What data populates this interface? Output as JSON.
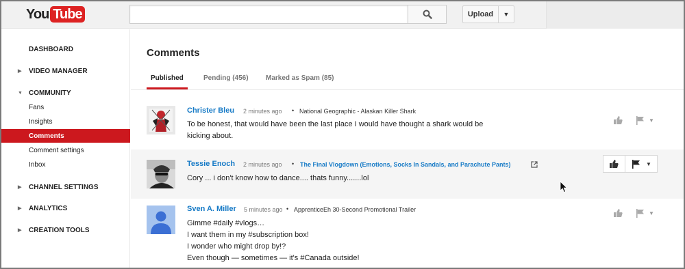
{
  "header": {
    "logo_you": "You",
    "logo_tube": "Tube",
    "search_value": "",
    "upload_label": "Upload"
  },
  "sidebar": {
    "sections": [
      {
        "label": "DASHBOARD",
        "has_arrow": false
      },
      {
        "label": "VIDEO MANAGER",
        "has_arrow": true
      },
      {
        "label": "COMMUNITY",
        "has_arrow": true,
        "expanded": true
      },
      {
        "label": "CHANNEL SETTINGS",
        "has_arrow": true
      },
      {
        "label": "ANALYTICS",
        "has_arrow": true
      },
      {
        "label": "CREATION TOOLS",
        "has_arrow": true
      }
    ],
    "community_items": [
      "Fans",
      "Insights",
      "Comments",
      "Comment settings",
      "Inbox"
    ],
    "active_item": "Comments"
  },
  "main": {
    "title": "Comments",
    "tabs": [
      {
        "label": "Published",
        "active": true
      },
      {
        "label": "Pending (456)",
        "active": false
      },
      {
        "label": "Marked as Spam (85)",
        "active": false
      }
    ]
  },
  "comments": [
    {
      "author": "Christer Bleu",
      "time": "2 minutes ago",
      "video": "National Geographic - Alaskan Killer Shark",
      "text": "To be honest, that would have been the last place I would have thought a shark would be\nkicking about."
    },
    {
      "author": "Tessie Enoch",
      "time": "2 minutes ago",
      "video": "The Final Vlogdown (Emotions, Socks In Sandals, and Parachute Pants)",
      "text": "Cory ... i don't know how to dance.... thats funny.......lol"
    },
    {
      "author": "Sven A. Miller",
      "time": "5 minutes ago",
      "video": "ApprenticeEh 30-Second Promotional Trailer",
      "text": "Gimme #daily #vlogs…\nI want them in my #subscription box!\nI wonder who might drop by!?\nEven though — sometimes — it's #Canada outside!"
    }
  ],
  "colors": {
    "accent_red": "#cc181e",
    "link_blue": "#167ac6"
  },
  "icons": [
    "search-icon",
    "chevron-down-icon",
    "thumbs-up-icon",
    "flag-icon",
    "external-link-icon",
    "cursor-icon"
  ]
}
